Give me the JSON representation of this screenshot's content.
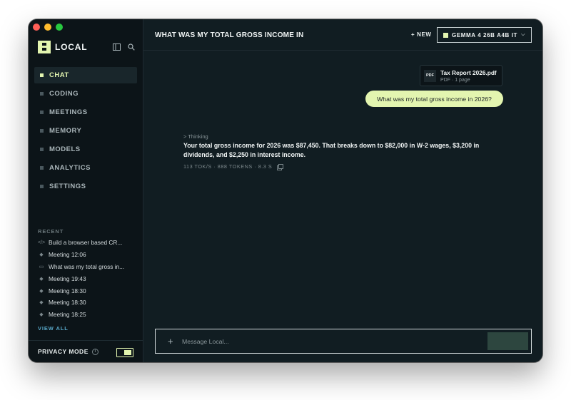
{
  "colors": {
    "accent": "#e3f5b0",
    "background": "#111d22",
    "sidebar": "#0c1418",
    "link": "#59a8c9"
  },
  "window_controls": [
    {
      "name": "close",
      "color": "#fe5f57"
    },
    {
      "name": "minimize",
      "color": "#febc2e"
    },
    {
      "name": "zoom",
      "color": "#28c840"
    }
  ],
  "sidebar": {
    "brand": "LOCAL",
    "icons": [
      "sidebar-toggle-icon",
      "search-icon"
    ],
    "nav": [
      {
        "label": "CHAT",
        "active": true
      },
      {
        "label": "CODING",
        "active": false
      },
      {
        "label": "MEETINGS",
        "active": false
      },
      {
        "label": "MEMORY",
        "active": false
      },
      {
        "label": "MODELS",
        "active": false
      },
      {
        "label": "ANALYTICS",
        "active": false
      },
      {
        "label": "SETTINGS",
        "active": false
      }
    ],
    "recent_label": "RECENT",
    "recent": [
      {
        "icon": "code-icon",
        "glyph": "</>",
        "label": "Build a browser based CR..."
      },
      {
        "icon": "meeting-icon",
        "glyph": "◆",
        "label": "Meeting 12:06"
      },
      {
        "icon": "chat-icon",
        "glyph": "▭",
        "label": "What was my total gross in..."
      },
      {
        "icon": "meeting-icon",
        "glyph": "◆",
        "label": "Meeting 19:43"
      },
      {
        "icon": "meeting-icon",
        "glyph": "◆",
        "label": "Meeting 18:30"
      },
      {
        "icon": "meeting-icon",
        "glyph": "◆",
        "label": "Meeting 18:30"
      },
      {
        "icon": "meeting-icon",
        "glyph": "◆",
        "label": "Meeting 18:25"
      }
    ],
    "view_all": "VIEW ALL",
    "privacy_label": "PRIVACY MODE",
    "privacy_on": true
  },
  "header": {
    "title": "WHAT WAS MY TOTAL GROSS INCOME IN",
    "new_label": "+ NEW",
    "model": "GEMMA 4 26B A4B IT"
  },
  "conversation": {
    "attachment": {
      "type_label": "PDF",
      "name": "Tax Report 2026.pdf",
      "meta": "PDF · 1 page"
    },
    "user_message": "What was my total gross income in 2026?",
    "thinking_label": "> Thinking",
    "answer": "Your total gross income for 2026 was $87,450. That breaks down to $82,000 in W-2 wages, $3,200 in dividends, and $2,250 in interest income.",
    "stats": "113 TOK/S · 888 TOKENS · 8.3 S"
  },
  "composer": {
    "placeholder": "Message Local...",
    "value": "",
    "send_label": ""
  }
}
